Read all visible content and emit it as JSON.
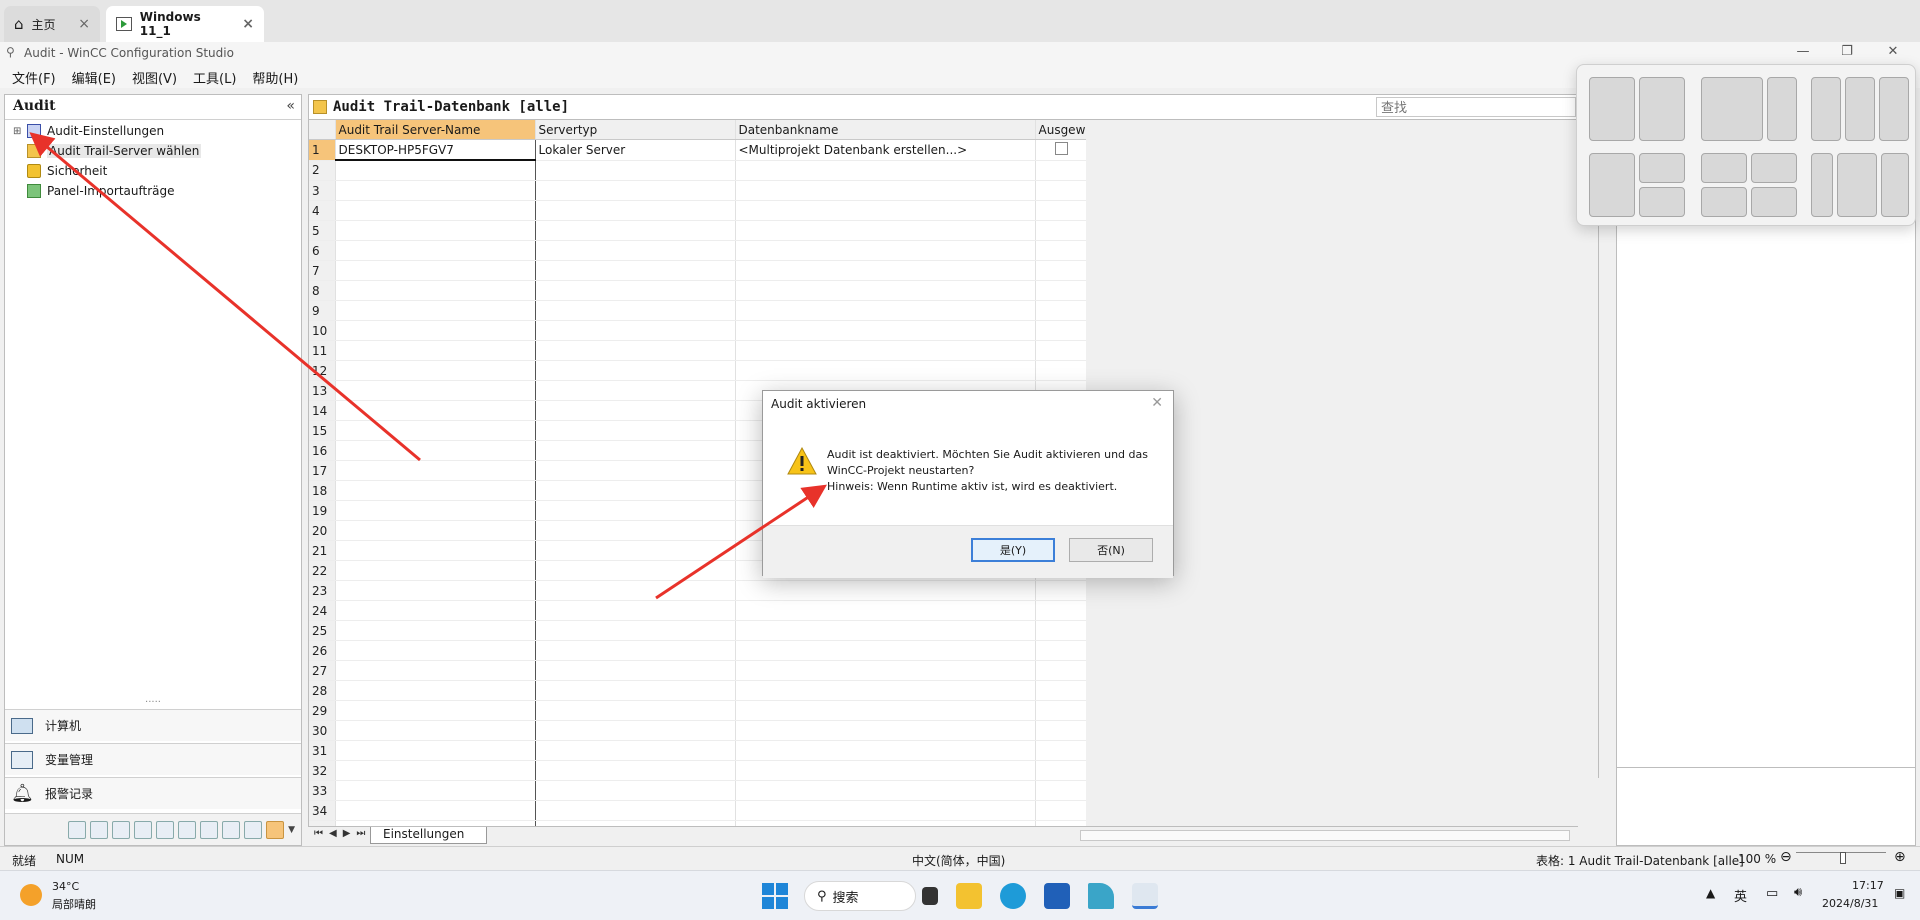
{
  "browser": {
    "tabs": [
      {
        "label": "主页",
        "icon": "home-icon"
      },
      {
        "label": "Windows 11_1",
        "icon": "vm-icon"
      }
    ],
    "tab_close": "×"
  },
  "window": {
    "title": "Audit - WinCC Configuration Studio",
    "min": "—",
    "restore": "❐",
    "close": "✕"
  },
  "menu": [
    "文件(F)",
    "编辑(E)",
    "视图(V)",
    "工具(L)",
    "帮助(H)"
  ],
  "nav": {
    "title": "Audit",
    "collapse": "«",
    "tree": [
      {
        "label": "Audit-Einstellungen",
        "icon": "audit-settings-icon"
      },
      {
        "label": "Audit Trail-Server wählen",
        "icon": "folder-icon"
      },
      {
        "label": "Sicherheit",
        "icon": "lock-icon"
      },
      {
        "label": "Panel-Importaufträge",
        "icon": "panel-import-icon"
      }
    ],
    "bottom": [
      {
        "label": "计算机",
        "icon": "computer-icon"
      },
      {
        "label": "变量管理",
        "icon": "tag-management-icon"
      },
      {
        "label": "报警记录",
        "icon": "alarm-bell-icon"
      }
    ],
    "grip": "·····"
  },
  "main": {
    "title": "Audit Trail-Datenbank [alle]",
    "search_placeholder": "查找",
    "columns": [
      "Audit Trail Server-Name",
      "Servertyp",
      "Datenbankname",
      "Ausgewä"
    ],
    "row1": {
      "server": "DESKTOP-HP5FGV7",
      "type": "Lokaler Server",
      "db": "<Multiprojekt Datenbank erstellen...>",
      "checked": false
    },
    "row_count": 36,
    "sheet_tab": "Einstellungen",
    "sheet_nav": "⏮◀▶⏭"
  },
  "dialog": {
    "title": "Audit aktivieren",
    "line1": "Audit ist deaktiviert. Möchten Sie Audit aktivieren und das",
    "line2": "WinCC-Projekt neustarten?",
    "line3": "Hinweis: Wenn Runtime aktiv ist, wird es deaktiviert.",
    "yes": "是(Y)",
    "no": "否(N)",
    "close": "✕"
  },
  "status": {
    "ready": "就绪",
    "num": "NUM",
    "ime": "中文(简体，中国)",
    "table": "表格: 1 Audit Trail-Datenbank [alle]",
    "zoom": "100 %",
    "zoom_minus": "⊖",
    "zoom_plus": "⊕"
  },
  "taskbar": {
    "temp": "34°C",
    "weather": "局部晴朗",
    "search": "搜索",
    "lang": "英",
    "time": "17:17",
    "date": "2024/8/31"
  },
  "colors": {
    "selection": "#f6c47a",
    "accent": "#3c7fd8",
    "arrow": "#e8322a"
  }
}
